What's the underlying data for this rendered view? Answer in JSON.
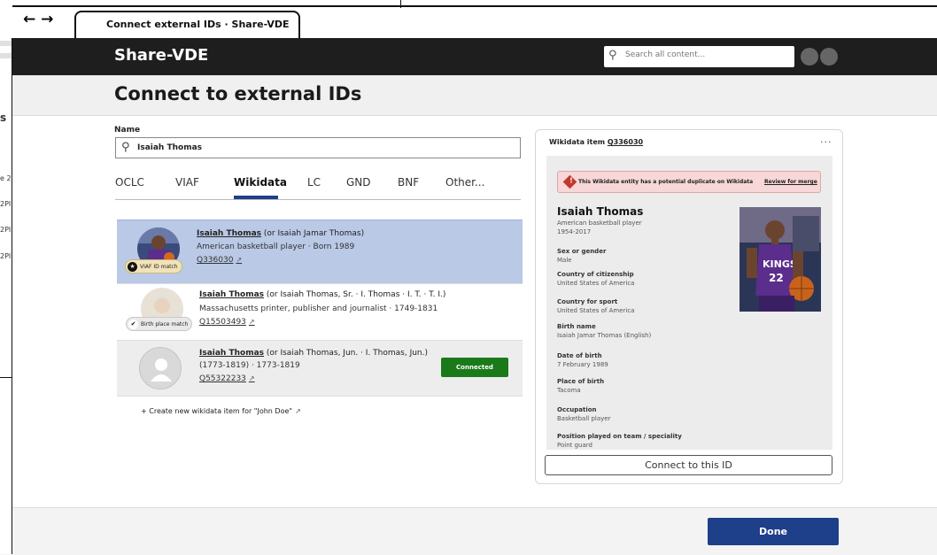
{
  "browser": {
    "nav_glyphs": "← →",
    "tab_title": "Connect external IDs · Share-VDE"
  },
  "ghost": {
    "labels": [
      "s",
      "e 2",
      "2PI",
      "2PI",
      "2PI"
    ]
  },
  "app": {
    "brand": "Share-VDE",
    "search_placeholder": "Search all content..."
  },
  "page": {
    "title": "Connect to external IDs",
    "name_label": "Name",
    "name_value": "Isaiah Thomas"
  },
  "tabs": [
    {
      "label": "OCLC",
      "active": false
    },
    {
      "label": "VIAF",
      "active": false
    },
    {
      "label": "Wikidata",
      "active": true
    },
    {
      "label": "LC",
      "active": false
    },
    {
      "label": "GND",
      "active": false
    },
    {
      "label": "BNF",
      "active": false
    },
    {
      "label": "Other...",
      "active": false
    }
  ],
  "results": [
    {
      "name": "Isaiah Thomas",
      "alt": " (or Isaiah Jamar Thomas)",
      "description": "American basketball player · Born 1989",
      "qid": "Q336030",
      "badge": "VIAF ID match",
      "selected": true
    },
    {
      "name": "Isaiah Thomas",
      "alt": " (or Isaiah Thomas, Sr. · I. Thomas · I. T. · T. I.)",
      "description": "Massachusetts printer, publisher and journalist · 1749-1831",
      "qid": "Q15503493",
      "badge": "Birth place match"
    },
    {
      "name": "Isaiah Thomas",
      "alt": " (or Isaiah Thomas, Jun. · I. Thomas, Jun.)",
      "description": "(1773-1819) · 1773-1819",
      "qid": "Q55322233",
      "status": "Connected"
    }
  ],
  "create_link": "+ Create new wikidata item for \"John Doe\"",
  "panel": {
    "header_prefix": "Wikidata item ",
    "header_qid": "Q336030",
    "more": "···",
    "duplicate_message": "This Wikidata entity has a potential duplicate on Wikidata",
    "review_link": "Review for merge",
    "entity_name": "Isaiah Thomas",
    "entity_desc": "American basketball player",
    "entity_years": "1954-2017",
    "properties": [
      {
        "label": "Sex or gender",
        "value": "Male"
      },
      {
        "label": "Country of citizenship",
        "value": "United States of America"
      },
      {
        "label": "Country for sport",
        "value": "United States of America"
      },
      {
        "label": "Birth name",
        "value": "Isaiah Jamar Thomas (English)"
      },
      {
        "label": "Date of birth",
        "value": "7 February 1989"
      },
      {
        "label": "Place of birth",
        "value": "Tacoma"
      },
      {
        "label": "Occupation",
        "value": "Basketball player"
      },
      {
        "label": "Position played on team / speciality",
        "value": "Point guard"
      }
    ],
    "connect_label": "Connect to this ID"
  },
  "footer": {
    "done_label": "Done"
  },
  "colors": {
    "brand_bar": "#1e1e1e",
    "accent": "#1e3f8a",
    "selected_row": "#b9c9e6",
    "connected": "#1a7a1a",
    "alert_bg": "#f7d7d7"
  }
}
